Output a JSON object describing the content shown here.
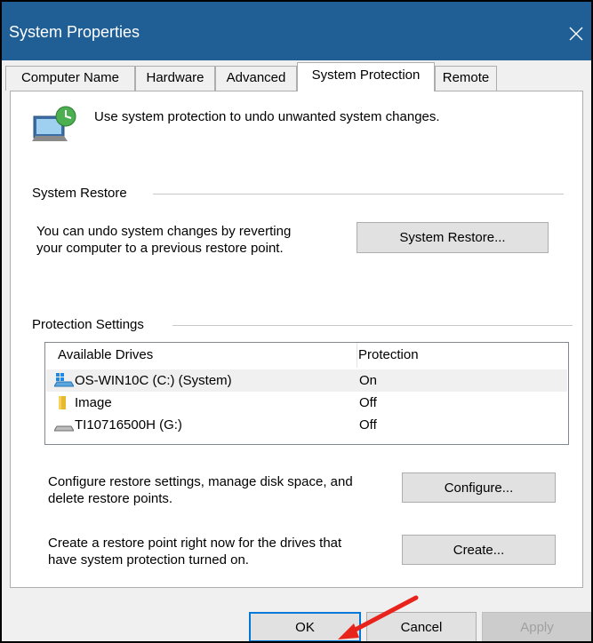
{
  "window": {
    "title": "System Properties"
  },
  "tabs": [
    {
      "label": "Computer Name"
    },
    {
      "label": "Hardware"
    },
    {
      "label": "Advanced"
    },
    {
      "label": "System Protection"
    },
    {
      "label": "Remote"
    }
  ],
  "active_tab": "System Protection",
  "intro_text": "Use system protection to undo unwanted system changes.",
  "system_restore": {
    "title": "System Restore",
    "description_line1": "You can undo system changes by reverting",
    "description_line2": "your computer to a previous restore point.",
    "button_label": "System Restore..."
  },
  "protection_settings": {
    "title": "Protection Settings",
    "columns": [
      "Available Drives",
      "Protection"
    ],
    "drives": [
      {
        "name": "OS-WIN10C (C:) (System)",
        "protection": "On",
        "icon": "system-drive-icon",
        "selected": true
      },
      {
        "name": "Image",
        "protection": "Off",
        "icon": "folder-icon",
        "selected": false
      },
      {
        "name": "TI10716500H (G:)",
        "protection": "Off",
        "icon": "drive-icon",
        "selected": false
      }
    ],
    "configure_text_line1": "Configure restore settings, manage disk space, and",
    "configure_text_line2": "delete restore points.",
    "configure_button": "Configure...",
    "create_text_line1": "Create a restore point right now for the drives that",
    "create_text_line2": "have system protection turned on.",
    "create_button": "Create..."
  },
  "footer": {
    "ok": "OK",
    "cancel": "Cancel",
    "apply": "Apply"
  },
  "colors": {
    "titlebar": "#1f5f96",
    "annotation_arrow": "#e8231c",
    "default_button_border": "#0078d7"
  }
}
